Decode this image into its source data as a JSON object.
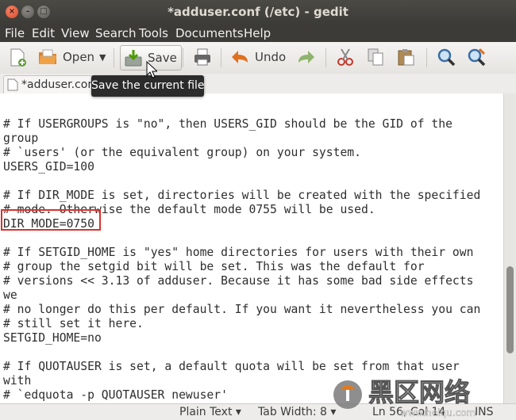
{
  "window": {
    "title": "*adduser.conf (/etc) - gedit",
    "controls": {
      "close": "×",
      "minimize": "–",
      "maximize": "□"
    }
  },
  "menu": [
    "File",
    "Edit",
    "View",
    "Search",
    "Tools",
    "Documents",
    "Help"
  ],
  "toolbar": {
    "open_label": "Open",
    "save_label": "Save",
    "undo_label": "Undo"
  },
  "tab": {
    "label": "*adduser.conf"
  },
  "tooltip": {
    "text": "Save the current file"
  },
  "editor": {
    "lines": [
      "",
      "",
      "# If USERGROUPS is \"no\", then USERS_GID should be the GID of the",
      "group",
      "# `users' (or the equivalent group) on your system.",
      "USERS_GID=100",
      "",
      "# If DIR_MODE is set, directories will be created with the specified",
      "# mode. Otherwise the default mode 0755 will be used.",
      "DIR_MODE=0750",
      "",
      "# If SETGID_HOME is \"yes\" home directories for users with their own",
      "# group the setgid bit will be set. This was the default for",
      "# versions << 3.13 of adduser. Because it has some bad side effects",
      "we",
      "# no longer do this per default. If you want it nevertheless you can",
      "# still set it here.",
      "SETGID_HOME=no",
      "",
      "# If QUOTAUSER is set, a default quota will be set from that user",
      "with",
      "# `edquota -p QUOTAUSER newuser'"
    ],
    "highlighted_line": "DIR_MODE=0750",
    "highlight_color": "#d9312c"
  },
  "statusbar": {
    "language": "Plain Text ▾",
    "tab_width": "Tab Width: 8 ▾",
    "position": "Ln 56, Col 14",
    "mode": "INS"
  },
  "watermark": {
    "text": "黑区网络",
    "url_text": "www.heiqu.com"
  }
}
